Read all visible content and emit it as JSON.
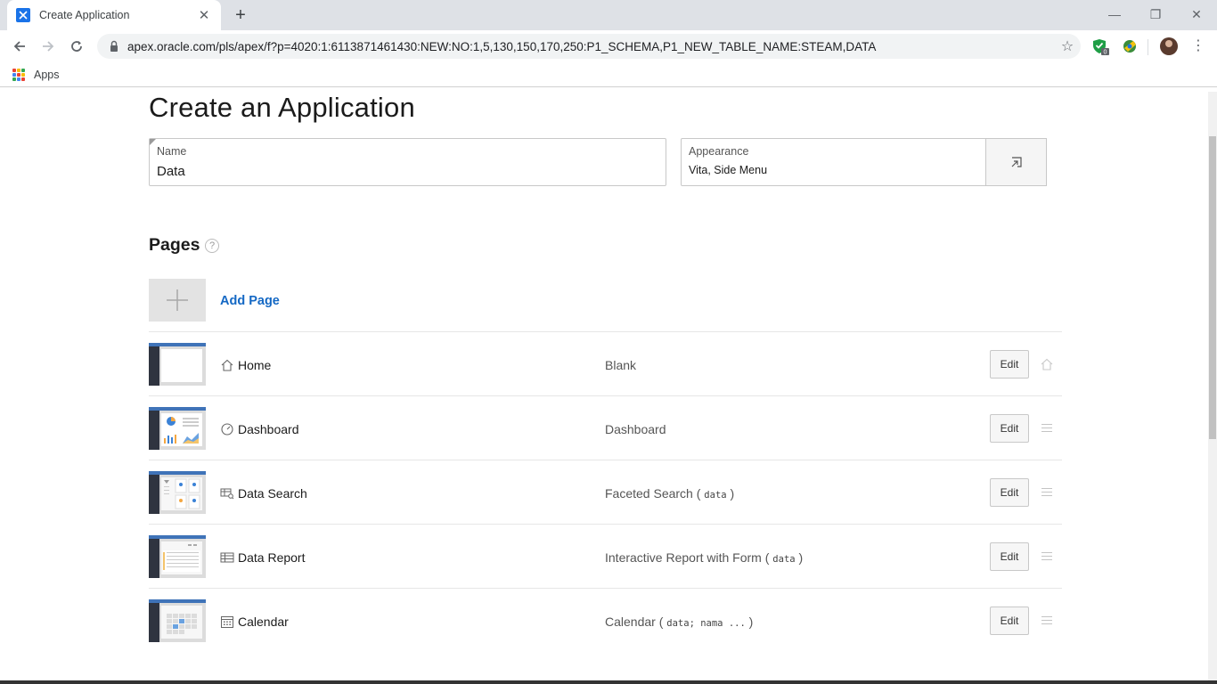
{
  "browser": {
    "tab_title": "Create Application",
    "url": "apex.oracle.com/pls/apex/f?p=4020:1:6113871461430:NEW:NO:1,5,130,150,170,250:P1_SCHEMA,P1_NEW_TABLE_NAME:STEAM,DATA",
    "bookmarks_label": "Apps",
    "extension_badge": "0"
  },
  "page": {
    "title": "Create an Application",
    "name_field": {
      "label": "Name",
      "value": "Data"
    },
    "appearance_field": {
      "label": "Appearance",
      "value": "Vita, Side Menu"
    },
    "pages_section": {
      "title": "Pages",
      "help": "?"
    },
    "add_page_label": "Add Page",
    "edit_label": "Edit",
    "rows": [
      {
        "name": "Home",
        "type": "Blank",
        "code": "",
        "icon": "home-icon"
      },
      {
        "name": "Dashboard",
        "type": "Dashboard",
        "code": "",
        "icon": "dashboard-icon"
      },
      {
        "name": "Data Search",
        "type": "Faceted Search",
        "code": "data",
        "icon": "faceted-search-icon"
      },
      {
        "name": "Data Report",
        "type": "Interactive Report with Form",
        "code": "data",
        "icon": "report-icon"
      },
      {
        "name": "Calendar",
        "type": "Calendar",
        "code": "data; nama ...",
        "icon": "calendar-icon"
      }
    ]
  },
  "colors": {
    "link": "#1468c4",
    "accent": "#3f73b8",
    "sidebar": "#2f3440"
  }
}
